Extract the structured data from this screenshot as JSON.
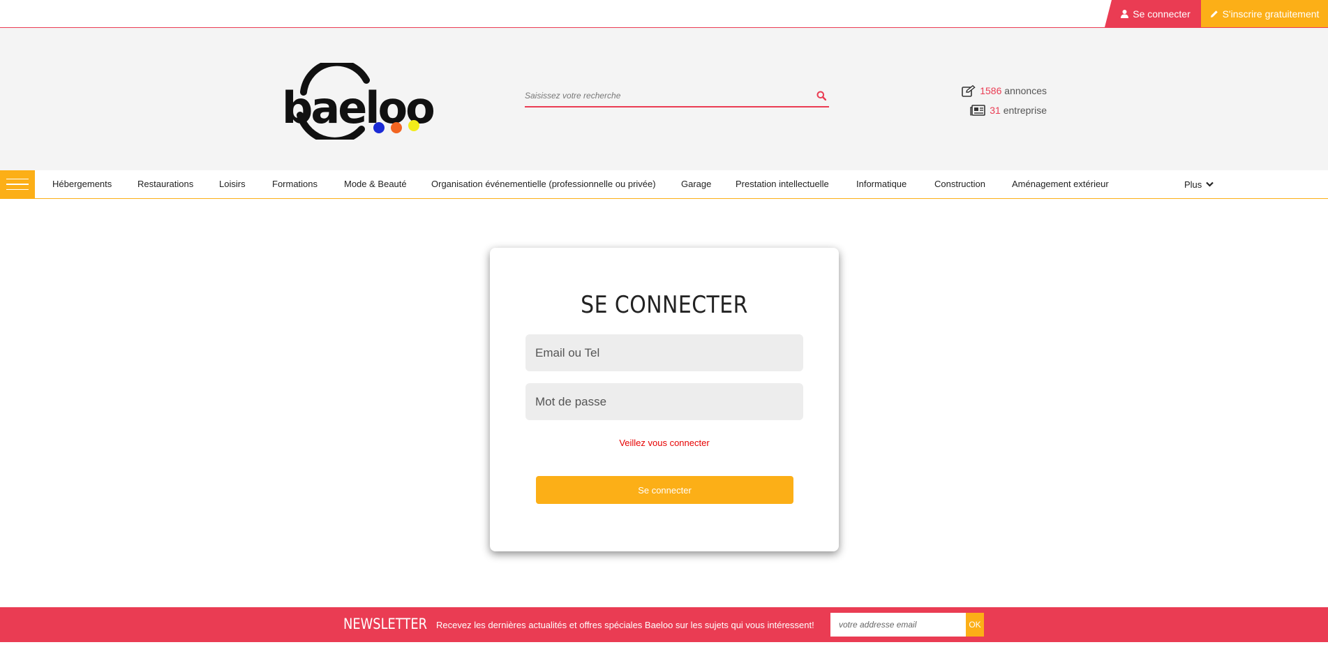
{
  "topbar": {
    "login_label": "Se connecter",
    "signup_label": "S'inscrire gratuitement"
  },
  "header": {
    "logo_alt": "baeloo",
    "search_placeholder": "Saisissez votre recherche",
    "stats": {
      "annonces_count": "1586",
      "annonces_label": "annonces",
      "entreprise_count": "31",
      "entreprise_label": "entreprise"
    }
  },
  "nav": {
    "items": [
      "Hébergements",
      "Restaurations",
      "Loisirs",
      "Formations",
      "Mode & Beauté",
      "Organisation événementielle (professionnelle ou privée)",
      "Garage",
      "Prestation intellectuelle",
      "Informatique",
      "Construction",
      "Aménagement extérieur"
    ],
    "more_label": "Plus"
  },
  "login": {
    "title": "Se connecter",
    "email_placeholder": "Email ou Tel",
    "password_placeholder": "Mot de passe",
    "message": "Veillez vous connecter",
    "submit_label": "Se connecter"
  },
  "newsletter": {
    "title": "Newsletter",
    "text": "Recevez les dernières actualités et offres spéciales Baeloo sur les sujets qui vous intéressent!",
    "email_placeholder": "votre addresse email",
    "ok_label": "OK"
  },
  "colors": {
    "accent_red": "#ea3c53",
    "accent_orange": "#fcaf17",
    "header_bg": "#f4f4f4"
  },
  "icons": {
    "login": "user-icon",
    "signup": "pencil-icon",
    "search": "search-icon",
    "annonces": "edit-icon",
    "entreprise": "newspaper-icon",
    "menu": "hamburger-icon",
    "more": "chevron-down-icon"
  }
}
